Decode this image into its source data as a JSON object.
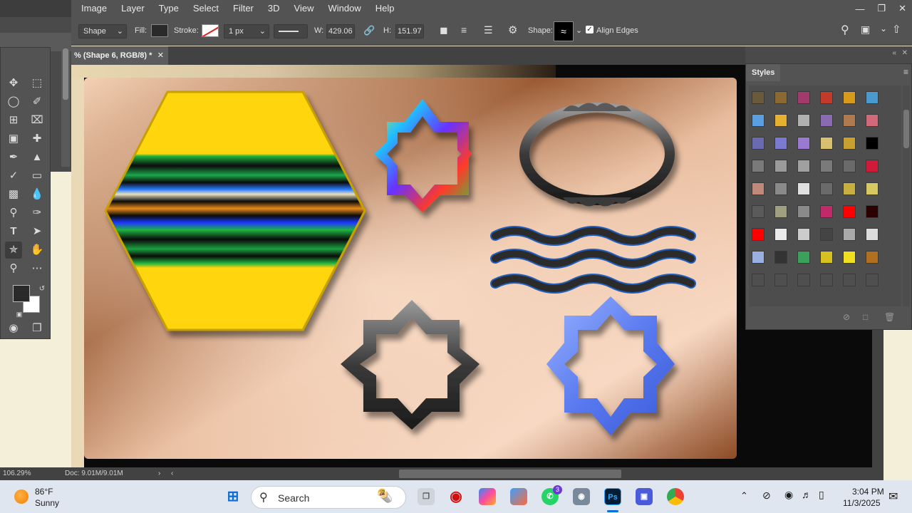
{
  "menu": {
    "items": [
      "Image",
      "Layer",
      "Type",
      "Select",
      "Filter",
      "3D",
      "View",
      "Window",
      "Help"
    ],
    "window_controls": [
      "minimize",
      "restore",
      "close"
    ]
  },
  "options": {
    "tool_mode": "Shape",
    "fill_label": "Fill:",
    "stroke_label": "Stroke:",
    "stroke_width": "1 px",
    "width_label": "W:",
    "width_value": "429.06",
    "height_label": "H:",
    "height_value": "151.97",
    "shape_label": "Shape:",
    "align_edges_label": "Align Edges",
    "align_edges_checked": true
  },
  "document": {
    "tab_title": "% (Shape 6, RGB/8) *"
  },
  "styles_panel": {
    "title": "Styles",
    "swatches": [
      [
        "#6b5a3a",
        "#8a6a30",
        "#a33a6e",
        "#c23a2a",
        "#d89a1a",
        "#4a9ad0"
      ],
      [
        "#5aa0e0",
        "#e6b030",
        "#b0b0b0",
        "#8a6ab0",
        "#b07a50",
        "#d06a7a"
      ],
      [
        "#6a6ab0",
        "#7a7ad0",
        "#9a7ad0",
        "#d8c070",
        "#c8a030",
        "#000000"
      ],
      [
        "#7a7a7a",
        "#9a9a9a",
        "#a0a0a0",
        "#7a7a7a",
        "#6a6a6a",
        "#d01a3a"
      ],
      [
        "#c08a7a",
        "#8a8a8a",
        "#e0e0e0",
        "#6a6a6a",
        "#c8b040",
        "#d8c860"
      ],
      [
        "#5a5a5a",
        "#a0a080",
        "#8a8a8a",
        "#c02a6a",
        "#ff0000",
        "#2a0000"
      ],
      [
        "#ff0000",
        "#eaeaea",
        "#cccccc",
        "#444444",
        "#aaaaaa",
        "#dddddd"
      ],
      [
        "#9ab0e0",
        "#333333",
        "#3aa05a",
        "#d8c020",
        "#f0e020",
        "#b07020"
      ]
    ]
  },
  "status": {
    "zoom": "106.29%",
    "doc_size": "Doc: 9.01M/9.01M"
  },
  "taskbar": {
    "weather_temp": "86°F",
    "weather_cond": "Sunny",
    "search_label": "Search",
    "whatsapp_badge": "3",
    "ps_label": "Ps",
    "time": "3:04 PM",
    "date": "11/3/2025"
  }
}
